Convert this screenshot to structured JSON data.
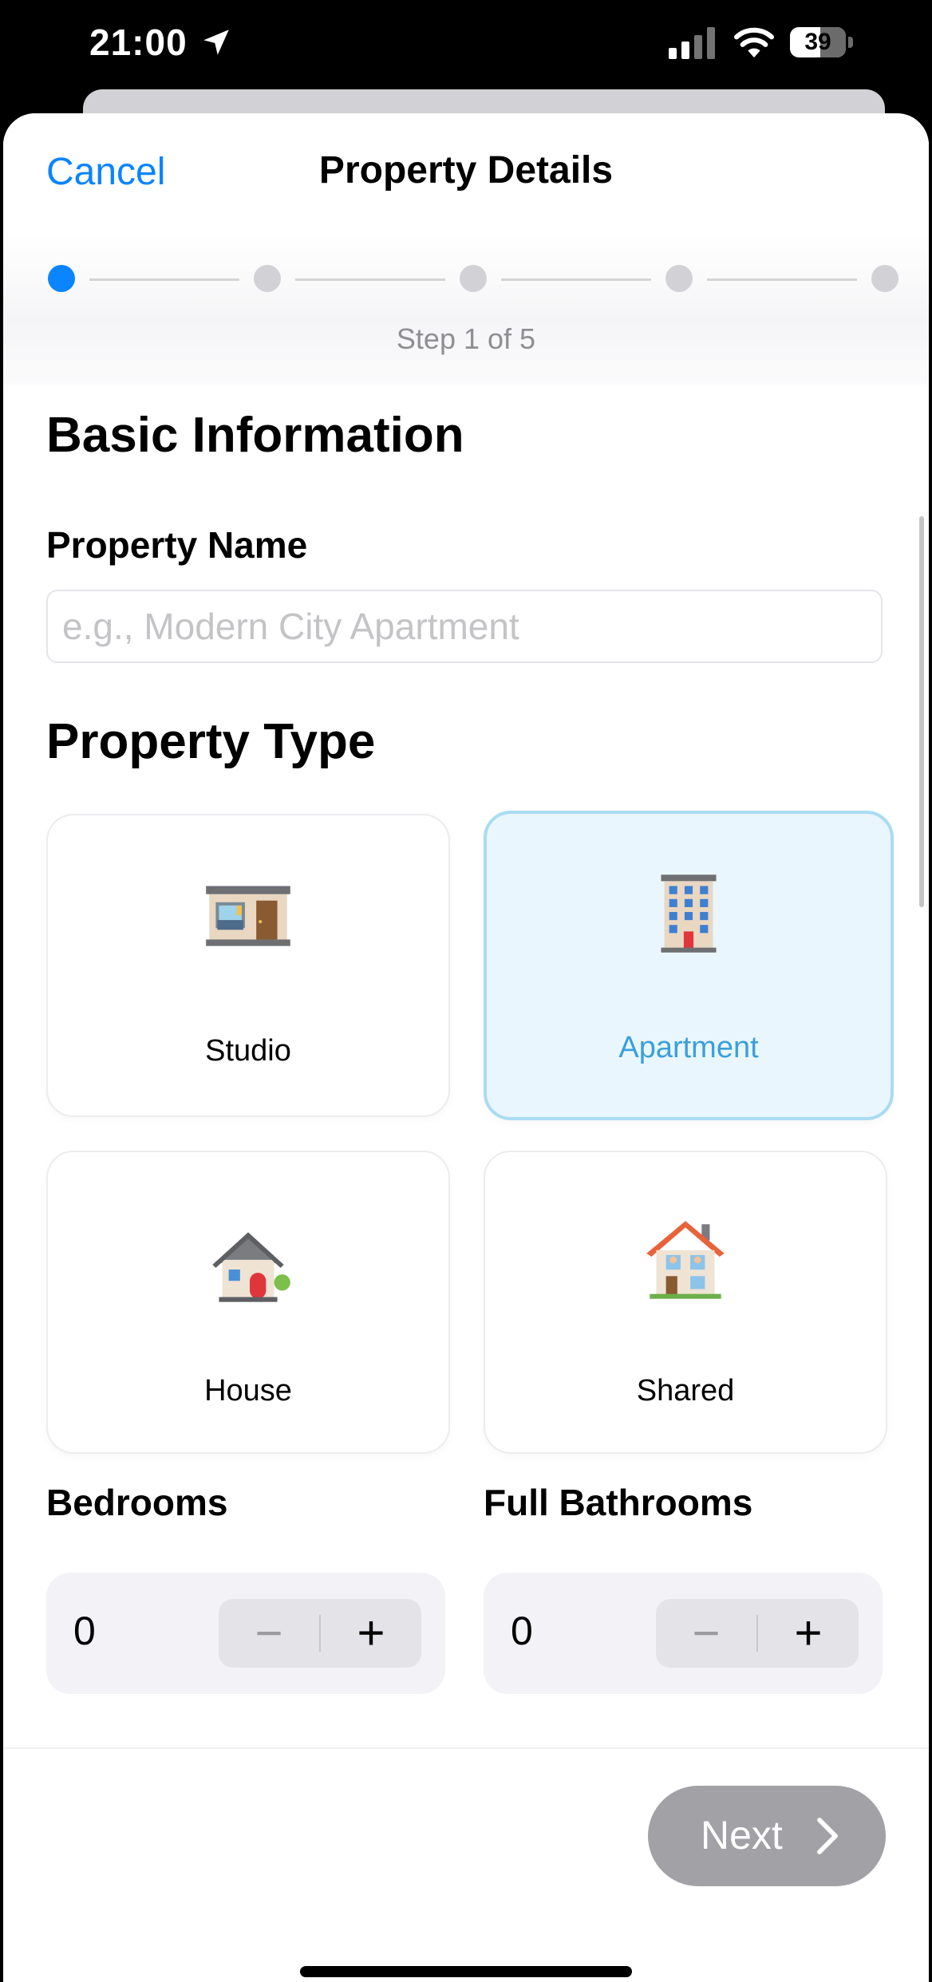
{
  "status_bar": {
    "time": "21:00",
    "battery": "39",
    "icons": [
      "location-arrow-icon",
      "cellular-signal-icon",
      "wifi-icon",
      "battery-icon"
    ]
  },
  "header": {
    "cancel_label": "Cancel",
    "title": "Property Details",
    "step_text": "Step 1 of 5",
    "steps_total": 5,
    "current_step": 1
  },
  "basic_info": {
    "heading": "Basic Information",
    "property_name": {
      "label": "Property Name",
      "value": "",
      "placeholder": "e.g., Modern City Apartment"
    }
  },
  "property_type": {
    "heading": "Property Type",
    "selected": "Apartment",
    "options": [
      {
        "label": "Studio",
        "icon": "studio-room-icon"
      },
      {
        "label": "Apartment",
        "icon": "apartment-building-icon"
      },
      {
        "label": "House",
        "icon": "house-icon"
      },
      {
        "label": "Shared",
        "icon": "shared-house-icon"
      }
    ]
  },
  "counters": {
    "bedrooms": {
      "label": "Bedrooms",
      "value": "0"
    },
    "bathrooms": {
      "label": "Full Bathrooms",
      "value": "0"
    },
    "minus_symbol": "−",
    "plus_symbol": "+"
  },
  "footer": {
    "next_label": "Next"
  },
  "colors": {
    "accent": "#0a84ff",
    "selected_card_bg": "#eaf6fd",
    "selected_card_border": "#a9dcf3",
    "selected_label": "#3aa0dc",
    "disabled_button": "#a2a2a6"
  }
}
